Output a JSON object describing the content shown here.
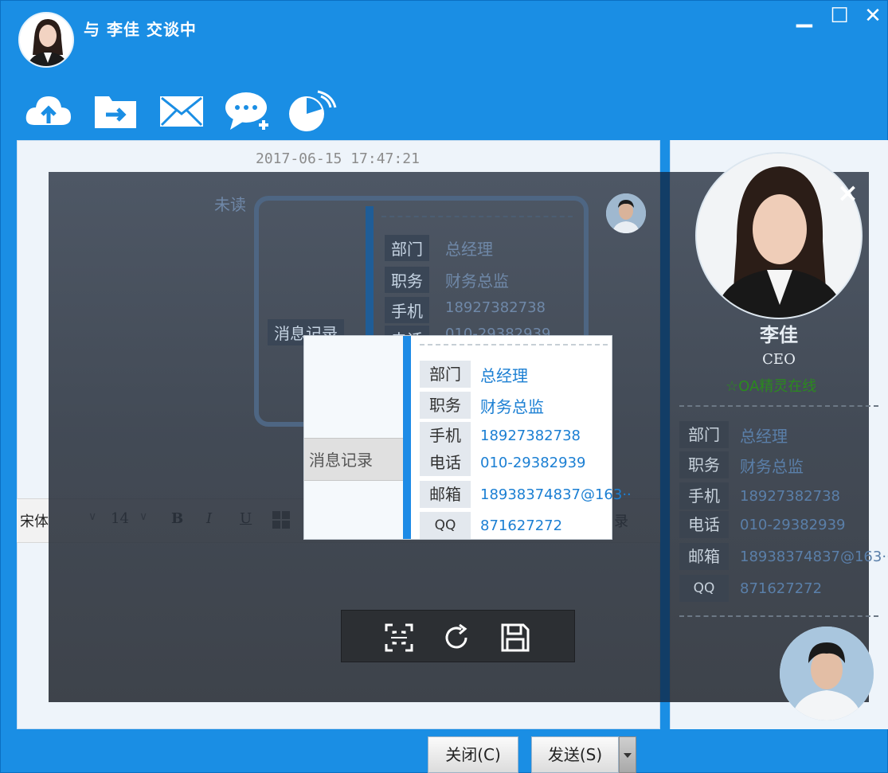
{
  "window": {
    "title": "与 李佳 交谈中",
    "minimize_label": "▁",
    "maximize_label": "☐",
    "close_label": "✕",
    "accent": "#1a8ee4"
  },
  "toolbar": {
    "icons": [
      "upload-cloud-icon",
      "send-file-icon",
      "mail-icon",
      "chat-add-icon",
      "remote-assist-icon"
    ]
  },
  "chat": {
    "timestamp": "2017-06-15 17:47:21",
    "unread_label": "未读",
    "bg_card": {
      "tab": "消息记录",
      "rows": [
        {
          "label": "部门",
          "value": "总经理"
        },
        {
          "label": "职务",
          "value": "财务总监"
        },
        {
          "label": "手机",
          "value": "18927382738"
        },
        {
          "label": "电话",
          "value": "010-29382939"
        }
      ]
    }
  },
  "format_bar": {
    "font": "宋体",
    "size": "14",
    "bold": "B",
    "italic": "I",
    "underline": "U",
    "history_fragment": "录"
  },
  "card": {
    "tab": "消息记录",
    "rows": [
      {
        "label": "部门",
        "value": "总经理"
      },
      {
        "label": "职务",
        "value": "财务总监"
      },
      {
        "label": "手机",
        "value": "18927382738"
      },
      {
        "label": "电话",
        "value": "010-29382939"
      },
      {
        "label": "邮箱",
        "value": "18938374837@163··"
      },
      {
        "label": "QQ",
        "value": "871627272"
      }
    ]
  },
  "profile": {
    "name": "李佳",
    "title": "CEO",
    "status": "☆OA精灵在线",
    "rows": [
      {
        "label": "部门",
        "value": "总经理"
      },
      {
        "label": "职务",
        "value": "财务总监"
      },
      {
        "label": "手机",
        "value": "18927382738"
      },
      {
        "label": "电话",
        "value": "010-29382939"
      },
      {
        "label": "邮箱",
        "value": "18938374837@163··"
      },
      {
        "label": "QQ",
        "value": "871627272"
      }
    ]
  },
  "capture": {
    "close_label": "×",
    "tools": [
      "fullscreen-select-icon",
      "refresh-icon",
      "save-icon"
    ]
  },
  "buttons": {
    "close": "关闭(C)",
    "send": "发送(S)"
  }
}
